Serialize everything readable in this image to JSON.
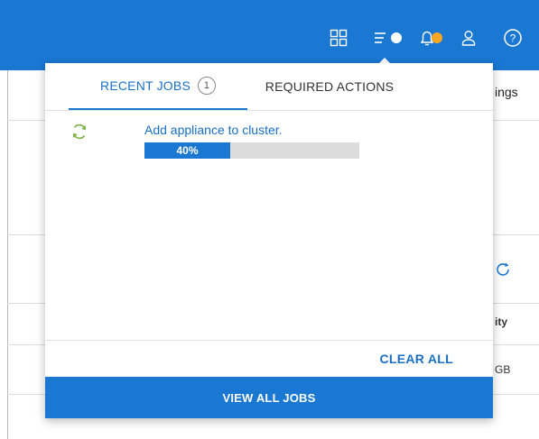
{
  "header": {
    "icons": [
      "apps-grid-icon",
      "jobs-icon",
      "alerts-bell-icon",
      "user-icon",
      "help-icon"
    ],
    "jobs_indicator_color": "#ffffff",
    "alerts_indicator_color": "#f5a623"
  },
  "background": {
    "settings_fragment": "ings",
    "capacity_header_fragment": "ity",
    "capacity_value_fragment": "GB"
  },
  "popover": {
    "tabs": {
      "recent_jobs": {
        "label": "RECENT JOBS",
        "count": "1"
      },
      "required_actions": {
        "label": "REQUIRED ACTIONS"
      }
    },
    "jobs": [
      {
        "title": "Add appliance to cluster.",
        "progress_label": "40%",
        "progress_fraction": 0.4
      }
    ],
    "clear_all_label": "CLEAR ALL",
    "view_all_label": "VIEW ALL JOBS"
  },
  "colors": {
    "brand_blue": "#1a77d2",
    "link_blue": "#1a6fc4",
    "progress_track": "#dcdcdc",
    "job_icon_green": "#7cb342"
  }
}
